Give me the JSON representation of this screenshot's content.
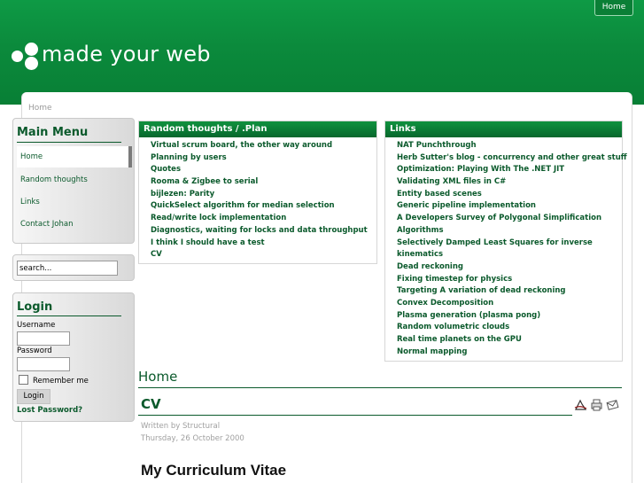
{
  "header": {
    "top_link": "Home",
    "site_title": "made your web"
  },
  "breadcrumb": "Home",
  "main_menu": {
    "title": "Main Menu",
    "items": [
      "Home",
      "Random thoughts",
      "Links",
      "Contact Johan"
    ]
  },
  "search": {
    "placeholder": "search..."
  },
  "login": {
    "title": "Login",
    "username_label": "Username",
    "password_label": "Password",
    "remember_label": "Remember me",
    "button": "Login",
    "lost_password": "Lost Password?"
  },
  "random_thoughts": {
    "title": "Random thoughts / .Plan",
    "items": [
      "Virtual scrum board, the other way around",
      "Planning by users",
      "Quotes",
      "Rooma & Zigbee to serial",
      "bijlezen: Parity",
      "QuickSelect algorithm for median selection",
      "Read/write lock implementation",
      "Diagnostics, waiting for locks and data throughput",
      "I think I should have a test",
      "CV"
    ]
  },
  "links": {
    "title": "Links",
    "items": [
      "NAT Punchthrough",
      "Herb Sutter's blog - concurrency and other great stuff",
      "Optimization: Playing With The .NET JIT",
      "Validating XML files in C#",
      "Entity based scenes",
      "Generic pipeline implementation",
      "A Developers Survey of Polygonal Simplification",
      "Algorithms",
      "Selectively Damped Least Squares for inverse",
      "kinematics",
      "Dead reckoning",
      "Fixing timestep for physics",
      "Targeting A variation of dead reckoning",
      "Convex Decomposition",
      "Plasma generation (plasma pong)",
      "Random volumetric clouds",
      "Real time planets on the GPU",
      "Normal mapping"
    ]
  },
  "content": {
    "section_heading": "Home",
    "article_title": "CV",
    "written_by": "Written by Structural",
    "date": "Thursday, 26 October 2000",
    "body_heading": "My Curriculum Vitae"
  },
  "icons": [
    "pdf-icon",
    "print-icon",
    "email-icon"
  ]
}
